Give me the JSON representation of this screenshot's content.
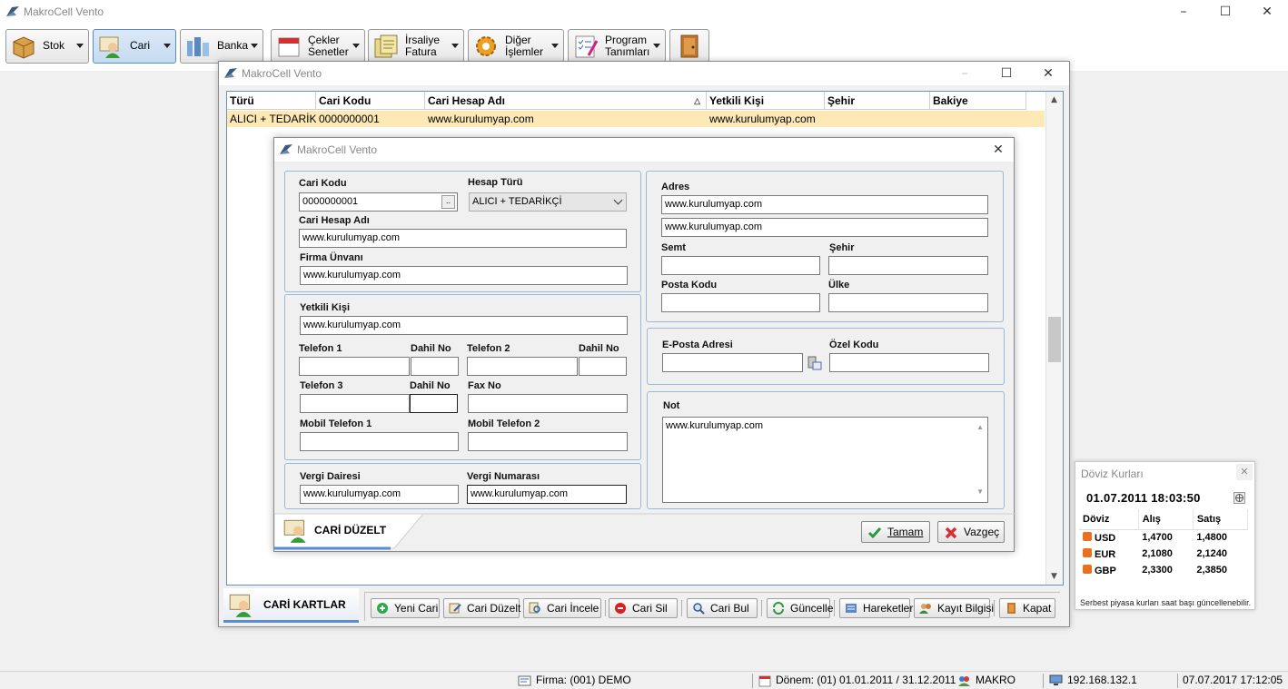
{
  "app": {
    "title": "MakroCell Vento"
  },
  "toolbar": {
    "items": [
      {
        "label1": "Stok",
        "label2": ""
      },
      {
        "label1": "Cari",
        "label2": ""
      },
      {
        "label1": "Banka",
        "label2": ""
      },
      {
        "label1": "Çekler",
        "label2": "Senetler"
      },
      {
        "label1": "İrsaliye",
        "label2": "Fatura"
      },
      {
        "label1": "Diğer",
        "label2": "İşlemler"
      },
      {
        "label1": "Program",
        "label2": "Tanımları"
      }
    ]
  },
  "cari_window": {
    "title": "MakroCell Vento",
    "columns": [
      "Türü",
      "Cari Kodu",
      "Cari Hesap Adı",
      "Yetkili Kişi",
      "Şehir",
      "Bakiye"
    ],
    "rows": [
      {
        "turu": "ALICI + TEDARİKÇİ",
        "kod": "0000000001",
        "ad": "www.kurulumyap.com",
        "yetkili": "www.kurulumyap.com",
        "sehir": "",
        "bakiye": ""
      }
    ],
    "tab_label": "CARİ KARTLAR",
    "buttons": [
      "Yeni Cari",
      "Cari Düzelt",
      "Cari İncele",
      "Cari Sil",
      "Cari Bul",
      "Güncelle",
      "Hareketler",
      "Kayıt Bilgisi",
      "Kapat"
    ]
  },
  "dialog": {
    "title": "MakroCell Vento",
    "labels": {
      "cari_kodu": "Cari Kodu",
      "hesap_turu": "Hesap Türü",
      "cari_hesap_adi": "Cari Hesap Adı",
      "firma_unvani": "Firma Ünvanı",
      "yetkili_kisi": "Yetkili Kişi",
      "telefon1": "Telefon 1",
      "dahil1": "Dahil No",
      "telefon2": "Telefon 2",
      "dahil2": "Dahil No",
      "telefon3": "Telefon 3",
      "dahil3": "Dahil No",
      "fax": "Fax No",
      "mobil1": "Mobil Telefon 1",
      "mobil2": "Mobil Telefon 2",
      "vergi_dairesi": "Vergi Dairesi",
      "vergi_no": "Vergi Numarası",
      "adres": "Adres",
      "semt": "Semt",
      "sehir": "Şehir",
      "posta_kodu": "Posta Kodu",
      "ulke": "Ülke",
      "eposta": "E-Posta Adresi",
      "ozel_kodu": "Özel Kodu",
      "not": "Not"
    },
    "values": {
      "cari_kodu": "0000000001",
      "hesap_turu": "ALICI + TEDARİKÇİ",
      "cari_hesap_adi": "www.kurulumyap.com",
      "firma_unvani": "www.kurulumyap.com",
      "yetkili_kisi": "www.kurulumyap.com",
      "vergi_dairesi": "www.kurulumyap.com",
      "vergi_no": "www.kurulumyap.com",
      "adres1": "www.kurulumyap.com",
      "adres2": "www.kurulumyap.com",
      "not": "www.kurulumyap.com"
    },
    "tab_label": "CARİ DÜZELT",
    "ok_label": "Tamam",
    "cancel_label": "Vazgeç"
  },
  "currency": {
    "title": "Döviz Kurları",
    "datetime": "01.07.2011 18:03:50",
    "headers": [
      "Döviz",
      "Alış",
      "Satış"
    ],
    "rows": [
      {
        "code": "USD",
        "buy": "1,4700",
        "sell": "1,4800"
      },
      {
        "code": "EUR",
        "buy": "2,1080",
        "sell": "2,1240"
      },
      {
        "code": "GBP",
        "buy": "2,3300",
        "sell": "2,3850"
      }
    ],
    "footer": "Serbest piyasa kurları saat başı güncellenebilir."
  },
  "status": {
    "firma": "Firma: (001) DEMO",
    "donem": "Dönem: (01) 01.01.2011 / 31.12.2011",
    "user": "MAKRO",
    "ip": "192.168.132.1",
    "datetime": "07.07.2017 17:12:05"
  }
}
